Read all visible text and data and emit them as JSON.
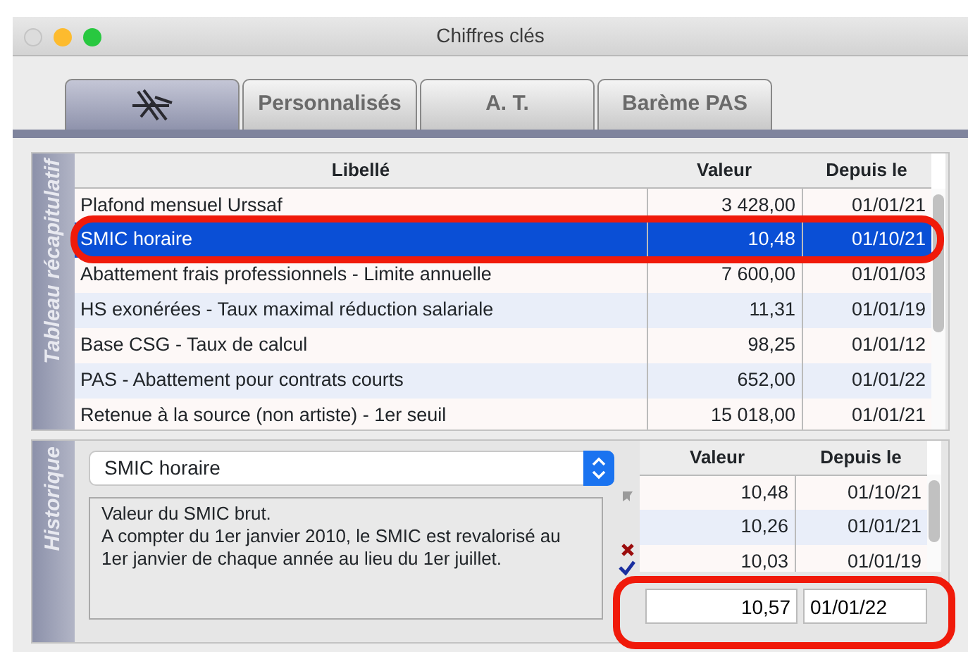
{
  "window": {
    "title": "Chiffres clés"
  },
  "tabs": [
    {
      "kind": "icon",
      "selected": true
    },
    {
      "kind": "text",
      "label": "Personnalisés",
      "selected": false
    },
    {
      "kind": "text",
      "label": "A. T.",
      "selected": false
    },
    {
      "kind": "text",
      "label": "Barème PAS",
      "selected": false
    }
  ],
  "summary": {
    "side_label": "Tableau récapitulatif",
    "columns": [
      "Libellé",
      "Valeur",
      "Depuis le"
    ],
    "rows": [
      {
        "label": "Plafond mensuel Urssaf",
        "value": "3 428,00",
        "since": "01/01/21",
        "selected": false
      },
      {
        "label": "SMIC horaire",
        "value": "10,48",
        "since": "01/10/21",
        "selected": true
      },
      {
        "label": "Abattement frais professionnels - Limite annuelle",
        "value": "7 600,00",
        "since": "01/01/03",
        "selected": false
      },
      {
        "label": "HS exonérées - Taux maximal réduction salariale",
        "value": "11,31",
        "since": "01/01/19",
        "selected": false
      },
      {
        "label": "Base CSG - Taux de calcul",
        "value": "98,25",
        "since": "01/01/12",
        "selected": false
      },
      {
        "label": "PAS - Abattement pour contrats courts",
        "value": "652,00",
        "since": "01/01/22",
        "selected": false
      },
      {
        "label": "Retenue à la source (non artiste) - 1er seuil",
        "value": "15 018,00",
        "since": "01/01/21",
        "selected": false
      }
    ]
  },
  "history": {
    "side_label": "Historique",
    "dropdown": {
      "value": "SMIC horaire"
    },
    "description": [
      "Valeur du SMIC brut.",
      "A compter du 1er janvier 2010, le SMIC est revalorisé au 1er janvier de chaque année au lieu du 1er juillet."
    ],
    "columns": [
      "Valeur",
      "Depuis le"
    ],
    "rows": [
      {
        "value": "10,48",
        "since": "01/10/21"
      },
      {
        "value": "10,26",
        "since": "01/01/21"
      },
      {
        "value": "10,03",
        "since": "01/01/19"
      }
    ],
    "new_entry": {
      "value": "10,57",
      "since": "01/01/22"
    }
  }
}
